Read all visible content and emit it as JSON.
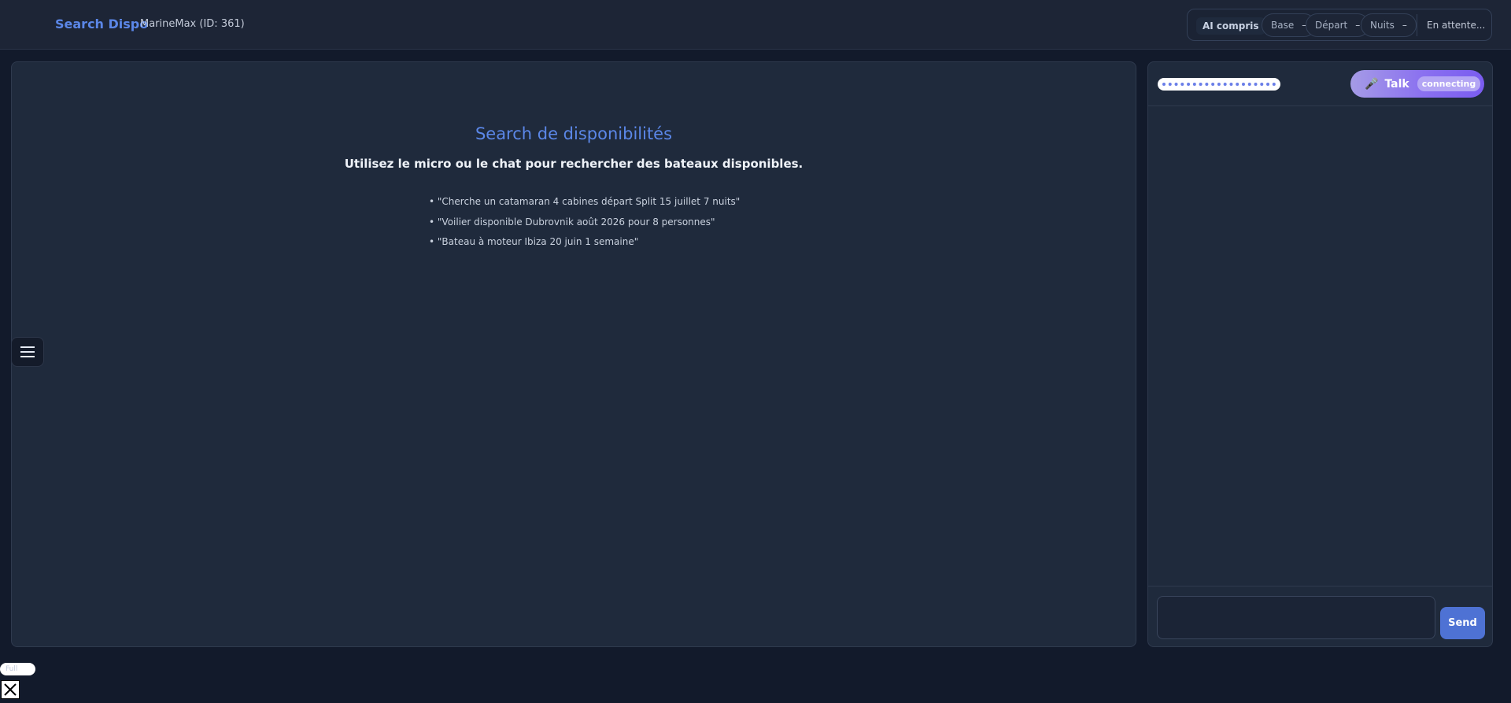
{
  "header": {
    "brand": "Search Dispo",
    "account": "MarineMax (ID: 361)",
    "status": {
      "ai": "AI compris",
      "chips": [
        {
          "label": "Base",
          "value": "–"
        },
        {
          "label": "Départ",
          "value": "–"
        },
        {
          "label": "Nuits",
          "value": "–"
        }
      ],
      "state": "En attente..."
    }
  },
  "main": {
    "title": "Search de disponibilités",
    "subtitle": "Utilisez le micro ou le chat pour rechercher des bateaux disponibles.",
    "examples": [
      "\"Cherche un catamaran 4 cabines départ Split 15 juillet 7 nuits\"",
      "\"Voilier disponible Dubrovnik août 2026 pour 8 personnes\"",
      "\"Bateau à moteur Ibiza 20 juin 1 semaine\""
    ]
  },
  "chat": {
    "talk": {
      "icon": "microphone-icon",
      "label": "Talk",
      "status": "connecting"
    },
    "input_value": "",
    "send_label": "Send"
  },
  "footer": {
    "tiny_pill": "Full"
  }
}
